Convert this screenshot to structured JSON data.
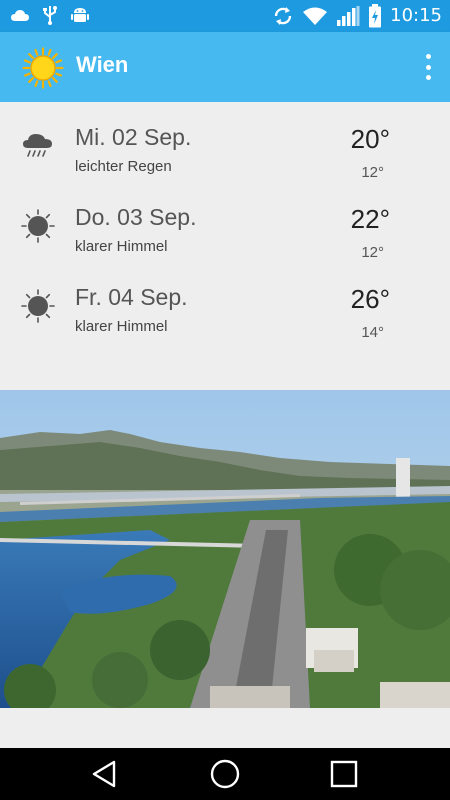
{
  "status_bar": {
    "time": "10:15",
    "icons": [
      "cloud-icon",
      "usb-icon",
      "android-icon",
      "sync-icon",
      "wifi-icon",
      "signal-icon",
      "battery-charging-icon"
    ]
  },
  "app_bar": {
    "title": "Wien",
    "icon": "sun-icon",
    "menu_icon": "overflow-menu-icon"
  },
  "forecast": [
    {
      "day": "Mi. 02 Sep.",
      "description": "leichter Regen",
      "high": "20°",
      "low": "12°",
      "icon": "rain-cloud-icon"
    },
    {
      "day": "Do. 03 Sep.",
      "description": "klarer Himmel",
      "high": "22°",
      "low": "12°",
      "icon": "sun-icon"
    },
    {
      "day": "Fr. 04 Sep.",
      "description": "klarer Himmel",
      "high": "26°",
      "low": "14°",
      "icon": "sun-icon"
    }
  ],
  "nav_bar": {
    "buttons": [
      "back-icon",
      "home-icon",
      "recents-icon"
    ]
  },
  "colors": {
    "status_bar": "#1e9be0",
    "app_bar": "#45b9f0",
    "background": "#eeeeee",
    "nav_bar": "#000000"
  }
}
